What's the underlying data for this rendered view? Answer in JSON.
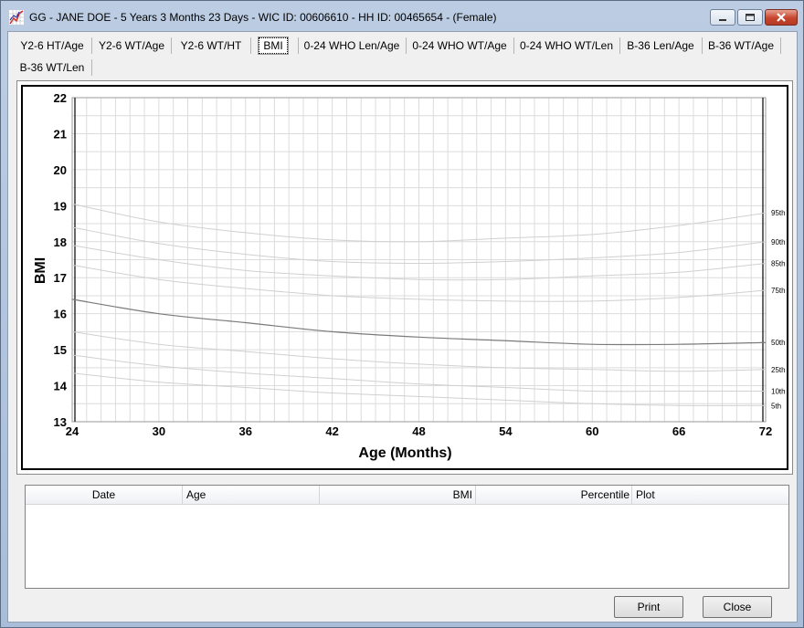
{
  "window": {
    "title": "GG - JANE DOE - 5 Years 3 Months 23 Days - WIC ID: 00606610 - HH ID: 00465654 - (Female)",
    "controls": [
      "minimize",
      "maximize",
      "close"
    ]
  },
  "tabs": [
    {
      "label": "Y2-6 HT/Age",
      "active": false
    },
    {
      "label": "Y2-6 WT/Age",
      "active": false
    },
    {
      "label": "Y2-6 WT/HT",
      "active": false
    },
    {
      "label": "BMI",
      "active": true
    },
    {
      "label": "0-24 WHO Len/Age",
      "active": false
    },
    {
      "label": "0-24 WHO WT/Age",
      "active": false
    },
    {
      "label": "0-24 WHO WT/Len",
      "active": false
    },
    {
      "label": "B-36 Len/Age",
      "active": false
    },
    {
      "label": "B-36 WT/Age",
      "active": false
    },
    {
      "label": "B-36 WT/Len",
      "active": false
    }
  ],
  "chart_data": {
    "type": "line",
    "xlabel": "Age (Months)",
    "ylabel": "BMI",
    "xlim": [
      24,
      72
    ],
    "ylim": [
      13,
      22
    ],
    "xticks": [
      24,
      30,
      36,
      42,
      48,
      54,
      60,
      66,
      72
    ],
    "yticks": [
      13,
      14,
      15,
      16,
      17,
      18,
      19,
      20,
      21,
      22
    ],
    "x": [
      24,
      30,
      36,
      42,
      48,
      54,
      60,
      66,
      72
    ],
    "grid": true,
    "series": [
      {
        "name": "95th",
        "values": [
          19.05,
          18.55,
          18.25,
          18.05,
          18.0,
          18.1,
          18.2,
          18.45,
          18.8
        ],
        "color": "#d0d0d0"
      },
      {
        "name": "90th",
        "values": [
          18.4,
          17.95,
          17.65,
          17.45,
          17.4,
          17.45,
          17.55,
          17.7,
          18.0
        ],
        "color": "#d0d0d0"
      },
      {
        "name": "85th",
        "values": [
          17.9,
          17.5,
          17.2,
          17.05,
          16.95,
          16.95,
          17.05,
          17.15,
          17.4
        ],
        "color": "#d0d0d0"
      },
      {
        "name": "75th",
        "values": [
          17.35,
          16.95,
          16.7,
          16.5,
          16.4,
          16.35,
          16.35,
          16.45,
          16.65
        ],
        "color": "#d0d0d0"
      },
      {
        "name": "50th",
        "values": [
          16.4,
          16.0,
          15.75,
          15.5,
          15.35,
          15.25,
          15.15,
          15.15,
          15.2
        ],
        "color": "#7a7a7a"
      },
      {
        "name": "25th",
        "values": [
          15.5,
          15.15,
          14.95,
          14.75,
          14.6,
          14.5,
          14.45,
          14.4,
          14.45
        ],
        "color": "#d0d0d0"
      },
      {
        "name": "10th",
        "values": [
          14.85,
          14.55,
          14.35,
          14.2,
          14.05,
          13.95,
          13.85,
          13.85,
          13.85
        ],
        "color": "#d0d0d0"
      },
      {
        "name": "5th",
        "values": [
          14.35,
          14.1,
          13.95,
          13.8,
          13.7,
          13.6,
          13.5,
          13.45,
          13.45
        ],
        "color": "#d0d0d0"
      }
    ]
  },
  "table": {
    "columns": [
      "Date",
      "Age",
      "BMI",
      "Percentile",
      "Plot"
    ],
    "rows": []
  },
  "buttons": {
    "print": "Print",
    "close": "Close"
  }
}
